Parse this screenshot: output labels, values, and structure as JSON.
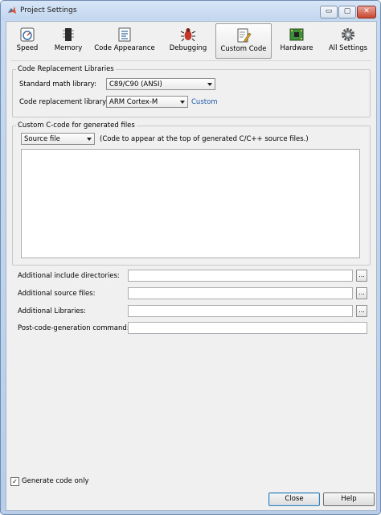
{
  "window": {
    "title": "Project Settings",
    "minimize_label": "▭",
    "maximize_label": "▢",
    "close_label": "✕"
  },
  "toolbar": {
    "items": [
      {
        "label": "Speed",
        "icon": "stopwatch-icon"
      },
      {
        "label": "Memory",
        "icon": "chip-icon"
      },
      {
        "label": "Code Appearance",
        "icon": "document-icon"
      },
      {
        "label": "Debugging",
        "icon": "bug-icon"
      },
      {
        "label": "Custom Code",
        "icon": "edit-document-icon",
        "active": true
      },
      {
        "label": "Hardware",
        "icon": "board-icon"
      },
      {
        "label": "All Settings",
        "icon": "gear-icon"
      }
    ]
  },
  "code_replacement": {
    "legend": "Code Replacement Libraries",
    "math_label": "Standard math library:",
    "math_value": "C89/C90 (ANSI)",
    "crl_label": "Code replacement library:",
    "crl_value": "ARM Cortex-M",
    "custom_link": "Custom"
  },
  "custom_code": {
    "legend": "Custom C-code for generated files",
    "file_select": "Source file",
    "hint": "(Code to appear at the top of generated C/C++ source files.)"
  },
  "fields": [
    {
      "label": "Additional include directories:",
      "browse": "..."
    },
    {
      "label": "Additional source files:",
      "browse": "..."
    },
    {
      "label": "Additional Libraries:",
      "browse": "..."
    },
    {
      "label": "Post-code-generation command:"
    }
  ],
  "footer": {
    "generate_only_label": "Generate code only",
    "generate_only_checked": true,
    "check_mark": "✓",
    "close_label": "Close",
    "help_label": "Help"
  }
}
